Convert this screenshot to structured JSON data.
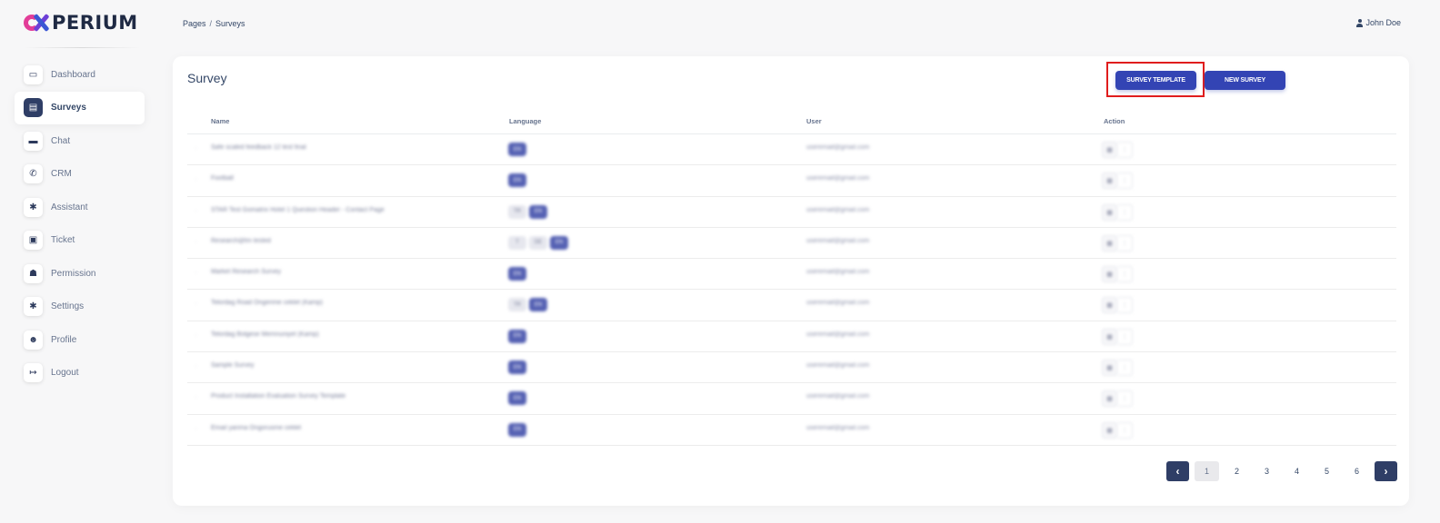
{
  "brand": {
    "name": "PERIUM"
  },
  "breadcrumb": {
    "parent": "Pages",
    "separator": "/",
    "current": "Surveys"
  },
  "user": {
    "name": "John Doe"
  },
  "sidebar": {
    "items": [
      {
        "label": "Dashboard",
        "icon": "dashboard-icon",
        "glyph": "▭"
      },
      {
        "label": "Surveys",
        "icon": "survey-icon",
        "glyph": "▤",
        "active": true
      },
      {
        "label": "Chat",
        "icon": "chat-icon",
        "glyph": "▬"
      },
      {
        "label": "CRM",
        "icon": "phone-icon",
        "glyph": "✆"
      },
      {
        "label": "Assistant",
        "icon": "gear-icon",
        "glyph": "✱"
      },
      {
        "label": "Ticket",
        "icon": "ticket-icon",
        "glyph": "▣"
      },
      {
        "label": "Permission",
        "icon": "permission-icon",
        "glyph": "☗"
      },
      {
        "label": "Settings",
        "icon": "settings-icon",
        "glyph": "✱"
      },
      {
        "label": "Profile",
        "icon": "profile-icon",
        "glyph": "☻"
      },
      {
        "label": "Logout",
        "icon": "logout-icon",
        "glyph": "↦"
      }
    ]
  },
  "survey": {
    "title": "Survey",
    "template_button": "SURVEY TEMPLATE",
    "new_button": "NEW SURVEY",
    "columns": {
      "name": "Name",
      "language": "Language",
      "user": "User",
      "action": "Action"
    },
    "rows": [
      {
        "name": "Safe scaled feedback 12 test final",
        "langs": [
          {
            "code": "EN",
            "alt": false
          }
        ],
        "user": "useremail@gmail.com"
      },
      {
        "name": "Football",
        "langs": [
          {
            "code": "EN",
            "alt": false
          }
        ],
        "user": "useremail@gmail.com"
      },
      {
        "name": "STAR Test Gomatrix Hotel 1 Question Header - Contact Page",
        "langs": [
          {
            "code": "TR",
            "alt": true
          },
          {
            "code": "EN",
            "alt": false
          }
        ],
        "user": "useremail@gmail.com"
      },
      {
        "name": "Research@tm tested",
        "langs": [
          {
            "code": "T",
            "alt": true
          },
          {
            "code": "DE",
            "alt": true
          },
          {
            "code": "EN",
            "alt": false
          }
        ],
        "user": "useremail@gmail.com"
      },
      {
        "name": "Market Research Survey",
        "langs": [
          {
            "code": "EN",
            "alt": false
          }
        ],
        "user": "useremail@gmail.com"
      },
      {
        "name": "Tekirdag Road Ongerime ceklet (Kamp)",
        "langs": [
          {
            "code": "TR",
            "alt": true
          },
          {
            "code": "EN",
            "alt": false
          }
        ],
        "user": "useremail@gmail.com"
      },
      {
        "name": "Tekirdag Bolgese Memnuniyet (Kamp)",
        "langs": [
          {
            "code": "EN",
            "alt": false
          }
        ],
        "user": "useremail@gmail.com"
      },
      {
        "name": "Sample Survey",
        "langs": [
          {
            "code": "EN",
            "alt": false
          }
        ],
        "user": "useremail@gmail.com"
      },
      {
        "name": "Product Installation Evaluation Survey Template",
        "langs": [
          {
            "code": "EN",
            "alt": false
          }
        ],
        "user": "useremail@gmail.com"
      },
      {
        "name": "Email yanma Ongorusme ceklet",
        "langs": [
          {
            "code": "EN",
            "alt": false
          }
        ],
        "user": "useremail@gmail.com"
      }
    ]
  },
  "pagination": {
    "pages": [
      "1",
      "2",
      "3",
      "4",
      "5",
      "6"
    ],
    "current": "1",
    "prev": "‹",
    "next": "›"
  },
  "colors": {
    "primary": "#3344b4",
    "dark": "#2f3e66",
    "highlight": "#e01d1d"
  }
}
